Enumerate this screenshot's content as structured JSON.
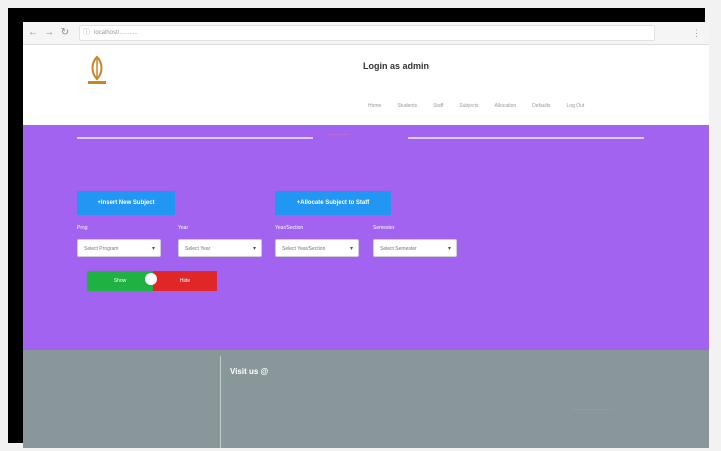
{
  "browser": {
    "url": "localhost/..........."
  },
  "header": {
    "title": "Login as admin",
    "nav": [
      "Home",
      "Students",
      "Staff",
      "Subjects",
      "Allocation",
      "Defaults",
      "Log Out"
    ]
  },
  "main": {
    "section_label": "...............",
    "insert_button": "+Insert New Subject",
    "allocate_button": "+Allocate Subject to Staff",
    "fields": [
      {
        "label": "Prog",
        "placeholder": "Select Program"
      },
      {
        "label": "Year",
        "placeholder": "Select Year"
      },
      {
        "label": "Year/Section",
        "placeholder": "Select Year/Section"
      },
      {
        "label": "Semester",
        "placeholder": "Select Semester"
      }
    ],
    "toggle": {
      "on_label": "Show",
      "off_label": "Hide"
    }
  },
  "footer": {
    "visit_label": "Visit us @",
    "visit_link": "..........",
    "text": "................................................",
    "copy": ".............................."
  },
  "colors": {
    "purple": "#a263f0",
    "button_blue": "#2196f3",
    "toggle_on": "#1fb141",
    "toggle_off": "#e02626",
    "footer": "#89969a"
  }
}
